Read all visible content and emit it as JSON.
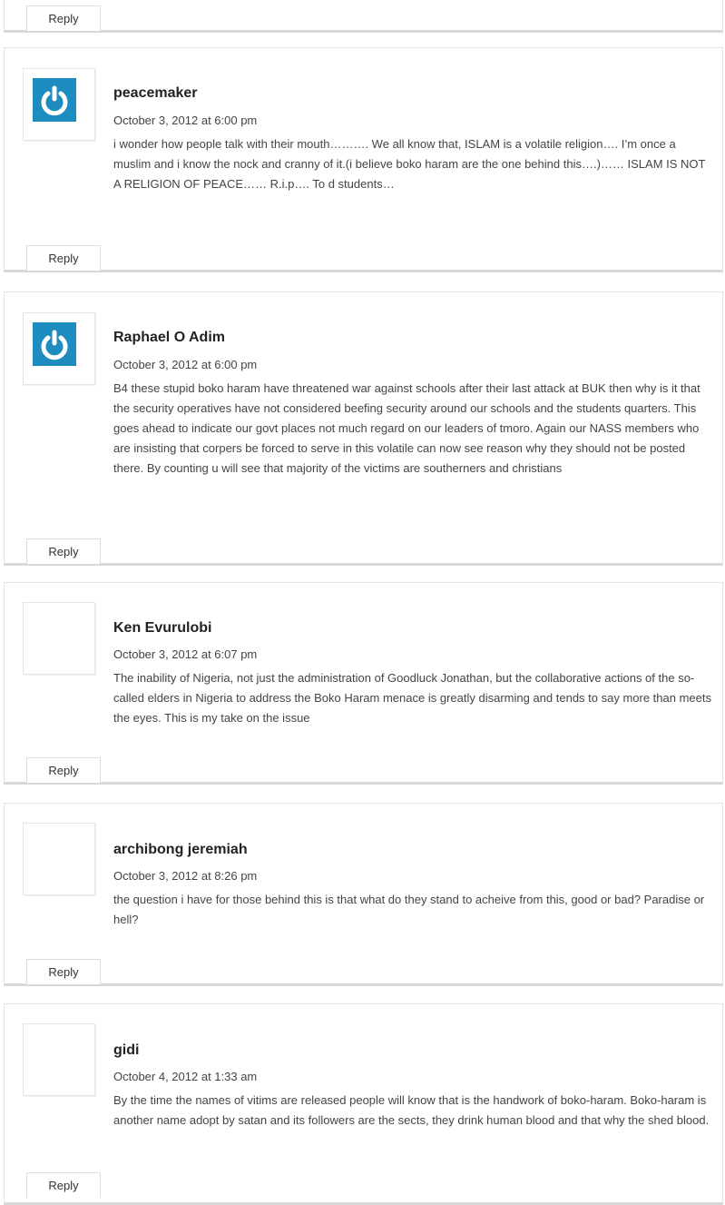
{
  "reply_label": "Reply",
  "comments": [
    {
      "author": "peacemaker",
      "date": "October 3, 2012 at 6:00 pm",
      "avatar": "gravatar-power-icon",
      "text": "i wonder how people talk with their mouth………. We all know that, ISLAM is a volatile religion…. I’m once a muslim and i know the nock and cranny of it.(i believe boko haram are the one behind this….)…… ISLAM IS NOT A RELIGION OF PEACE…… R.i.p…. To d students…"
    },
    {
      "author": "Raphael O Adim",
      "date": "October 3, 2012 at 6:00 pm",
      "avatar": "gravatar-power-icon",
      "text": "B4 these stupid boko haram have threatened war against schools after their last attack at BUK then why is it that the security operatives have not considered beefing security around our schools and the students quarters. This goes ahead to indicate our govt places not much regard on our leaders of tmoro. Again our NASS members who are insisting that corpers be forced to serve in this volatile can now see reason why they should not be posted there. By counting u will see that majority of the victims are southerners and christians"
    },
    {
      "author": "Ken Evurulobi",
      "date": "October 3, 2012 at 6:07 pm",
      "avatar": "blank",
      "text": "The inability of Nigeria, not just the administration of Goodluck Jonathan, but the collaborative actions of the so-called elders in Nigeria to address the Boko Haram menace is greatly disarming and tends to say more than meets the eyes. This is my take on the issue"
    },
    {
      "author": "archibong jeremiah",
      "date": "October 3, 2012 at 8:26 pm",
      "avatar": "blank",
      "text": "the question i have for those behind this is that what do they stand to acheive from this, good or bad? Paradise or hell?"
    },
    {
      "author": "gidi",
      "date": "October 4, 2012 at 1:33 am",
      "avatar": "blank",
      "text": "By the time the names of vitims are released people will know that is the handwork of boko-haram. Boko-haram is another name adopt by satan and its followers are the sects, they drink human blood and that why the shed blood."
    }
  ],
  "colors": {
    "gravatar_bg": "#1e8cbe",
    "border": "#e3e3e3"
  }
}
